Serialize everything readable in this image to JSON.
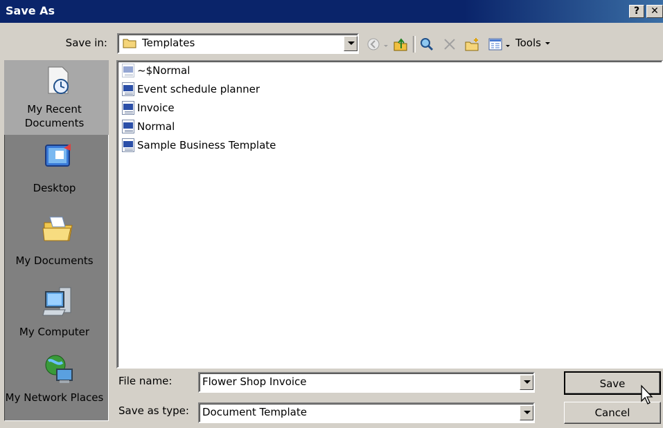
{
  "window": {
    "title": "Save As",
    "help_glyph": "?",
    "close_glyph": "✕"
  },
  "toolbar": {
    "save_in_label": "Save in:",
    "location": "Templates",
    "tools_label": "Tools"
  },
  "places": [
    {
      "label": "My Recent Documents",
      "icon": "recent-documents-icon"
    },
    {
      "label": "Desktop",
      "icon": "desktop-icon"
    },
    {
      "label": "My Documents",
      "icon": "my-documents-icon"
    },
    {
      "label": "My Computer",
      "icon": "my-computer-icon"
    },
    {
      "label": "My Network Places",
      "icon": "network-places-icon"
    }
  ],
  "files": [
    {
      "name": "~$Normal"
    },
    {
      "name": "Event schedule planner"
    },
    {
      "name": "Invoice"
    },
    {
      "name": "Normal"
    },
    {
      "name": "Sample Business Template"
    }
  ],
  "form": {
    "file_name_label": "File name:",
    "file_name_value": "Flower Shop Invoice",
    "save_as_type_label": "Save as type:",
    "save_as_type_value": "Document Template"
  },
  "buttons": {
    "save": "Save",
    "cancel": "Cancel"
  },
  "colors": {
    "title_bar": "#0a246a",
    "face": "#d4d0c8",
    "places_bg": "#808080",
    "word_blue": "#2b4fa8"
  }
}
